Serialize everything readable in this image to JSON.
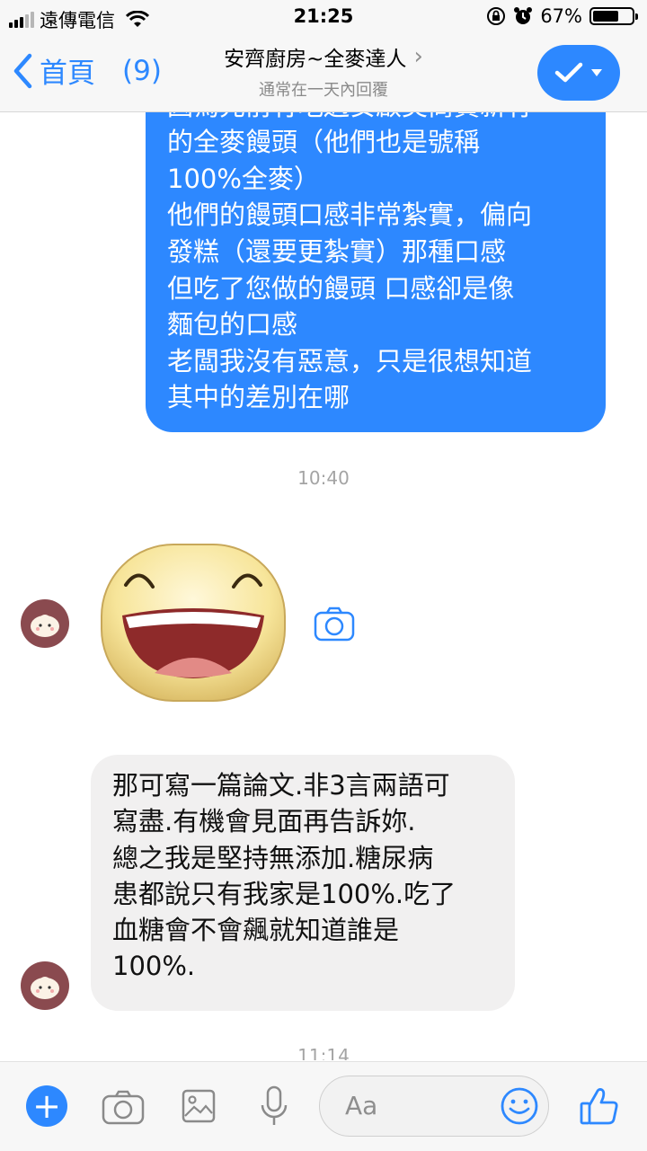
{
  "status_bar": {
    "carrier": "遠傳電信",
    "time": "21:25",
    "battery_percent": "67%",
    "battery_level": 0.67,
    "signal_bars_active": 3,
    "icons": [
      "signal-icon",
      "wifi-icon",
      "orientation-lock-icon",
      "alarm-icon",
      "battery-icon"
    ]
  },
  "header": {
    "back_label": "首頁",
    "unread_count": "(9)",
    "title": "安齊廚房~全麥達人",
    "subtitle": "通常在一天內回覆",
    "accent_color": "#2d88ff"
  },
  "messages": {
    "outgoing": {
      "lines": [
        "因為先前有吃過安啟美商買新有",
        "的全麥饅頭（他們也是號稱",
        "100%全麥）",
        "他們的饅頭口感非常紮實，偏向",
        "發糕（還要更紮實）那種口感",
        "但吃了您做的饅頭 口感卻是像",
        "麵包的口感",
        "老闆我沒有惡意，只是很想知道",
        "其中的差別在哪"
      ]
    },
    "time_1": "10:40",
    "incoming": {
      "lines": [
        "那可寫一篇論文.非3言兩語可",
        "寫盡.有機會見面再告訴妳.",
        "總之我是堅持無添加.糖尿病",
        "患都說只有我家是100%.吃了",
        "血糖會不會飆就知道誰是",
        "100%."
      ]
    },
    "time_2": "11:14"
  },
  "composer": {
    "placeholder": "Aa",
    "icons": [
      "plus-icon",
      "camera-icon",
      "gallery-icon",
      "microphone-icon",
      "smiley-icon",
      "thumbs-up-icon"
    ]
  }
}
